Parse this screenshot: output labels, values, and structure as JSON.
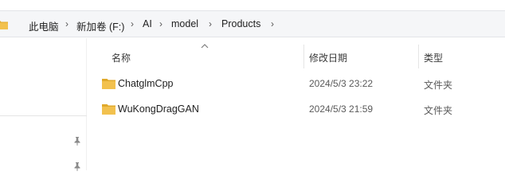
{
  "breadcrumb": {
    "items": [
      "此电脑",
      "新加卷 (F:)",
      "AI",
      "model",
      "Products"
    ],
    "separator": "›"
  },
  "columns": {
    "name": "名称",
    "date_modified": "修改日期",
    "type": "类型"
  },
  "files": [
    {
      "name": "ChatglmCpp",
      "date": "2024/5/3 23:22",
      "type": "文件夹"
    },
    {
      "name": "WuKongDragGAN",
      "date": "2024/5/3 21:59",
      "type": "文件夹"
    }
  ],
  "colors": {
    "folder": "#f2c14e",
    "folder_dark": "#e0a92b",
    "address_bg": "#f5f6f8"
  },
  "icons": {
    "address_folder": "folder-icon",
    "pin": "pin-icon",
    "sort": "sort-up-arrow-icon"
  }
}
